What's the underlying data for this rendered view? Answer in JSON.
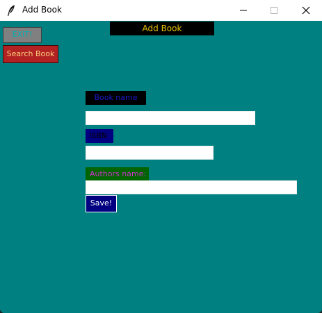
{
  "window": {
    "title": "Add Book",
    "icon": "feather-icon",
    "controls": {
      "minimize_icon": "minimize-icon",
      "maximize_icon": "maximize-icon",
      "close_icon": "close-icon"
    },
    "background_color": "#008080"
  },
  "toolbar": {
    "exit_label": "EXIT!",
    "search_label": "Search Book"
  },
  "header": {
    "title": "Add Book"
  },
  "form": {
    "book_name_label": "Book name",
    "book_name_value": "",
    "isbn_label": "ISBN",
    "isbn_value": "",
    "authors_label": "Authors name:",
    "authors_value": "",
    "save_label": "Save!"
  },
  "colors": {
    "exit_bg": "#808080",
    "search_bg": "#b22222",
    "header_bg": "#000000",
    "header_text": "#e8c000",
    "save_bg": "#000080"
  }
}
